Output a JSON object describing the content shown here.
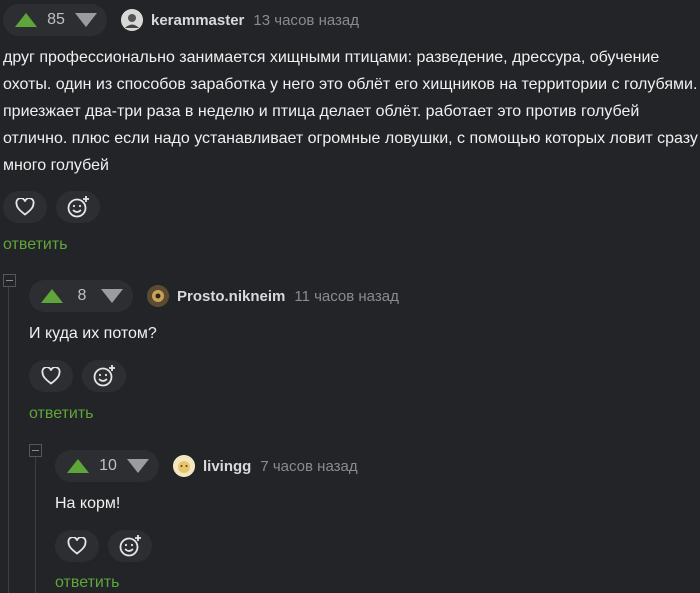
{
  "comments": [
    {
      "votes": "85",
      "username": "kerammaster",
      "time": "13 часов назад",
      "text_lines": [
        "друг профессионально занимается хищными птицами: разведение, дрессура, обучение",
        "охоты. один из способов заработка у него это облёт его хищников на территории с голубями.",
        "приезжает два-три раза в неделю и птица делает облёт. работает это против голубей",
        "отлично. плюс если надо устанавливает огромные ловушки, с помощью которых ловит сразу",
        "много голубей"
      ],
      "reply_label": "ответить"
    },
    {
      "votes": "8",
      "username": "Prosto.nikneim",
      "time": "11 часов назад",
      "text_lines": [
        "И куда их потом?"
      ],
      "reply_label": "ответить"
    },
    {
      "votes": "10",
      "username": "livingg",
      "time": "7 часов назад",
      "text_lines": [
        "На корм!"
      ],
      "reply_label": "ответить"
    }
  ],
  "colors": {
    "background": "#232427",
    "accent_green": "#5fa63a",
    "pill": "#2d2e32"
  },
  "icons": [
    "heart-icon",
    "emoji-add-icon",
    "upvote-icon",
    "downvote-icon",
    "collapse-icon"
  ]
}
